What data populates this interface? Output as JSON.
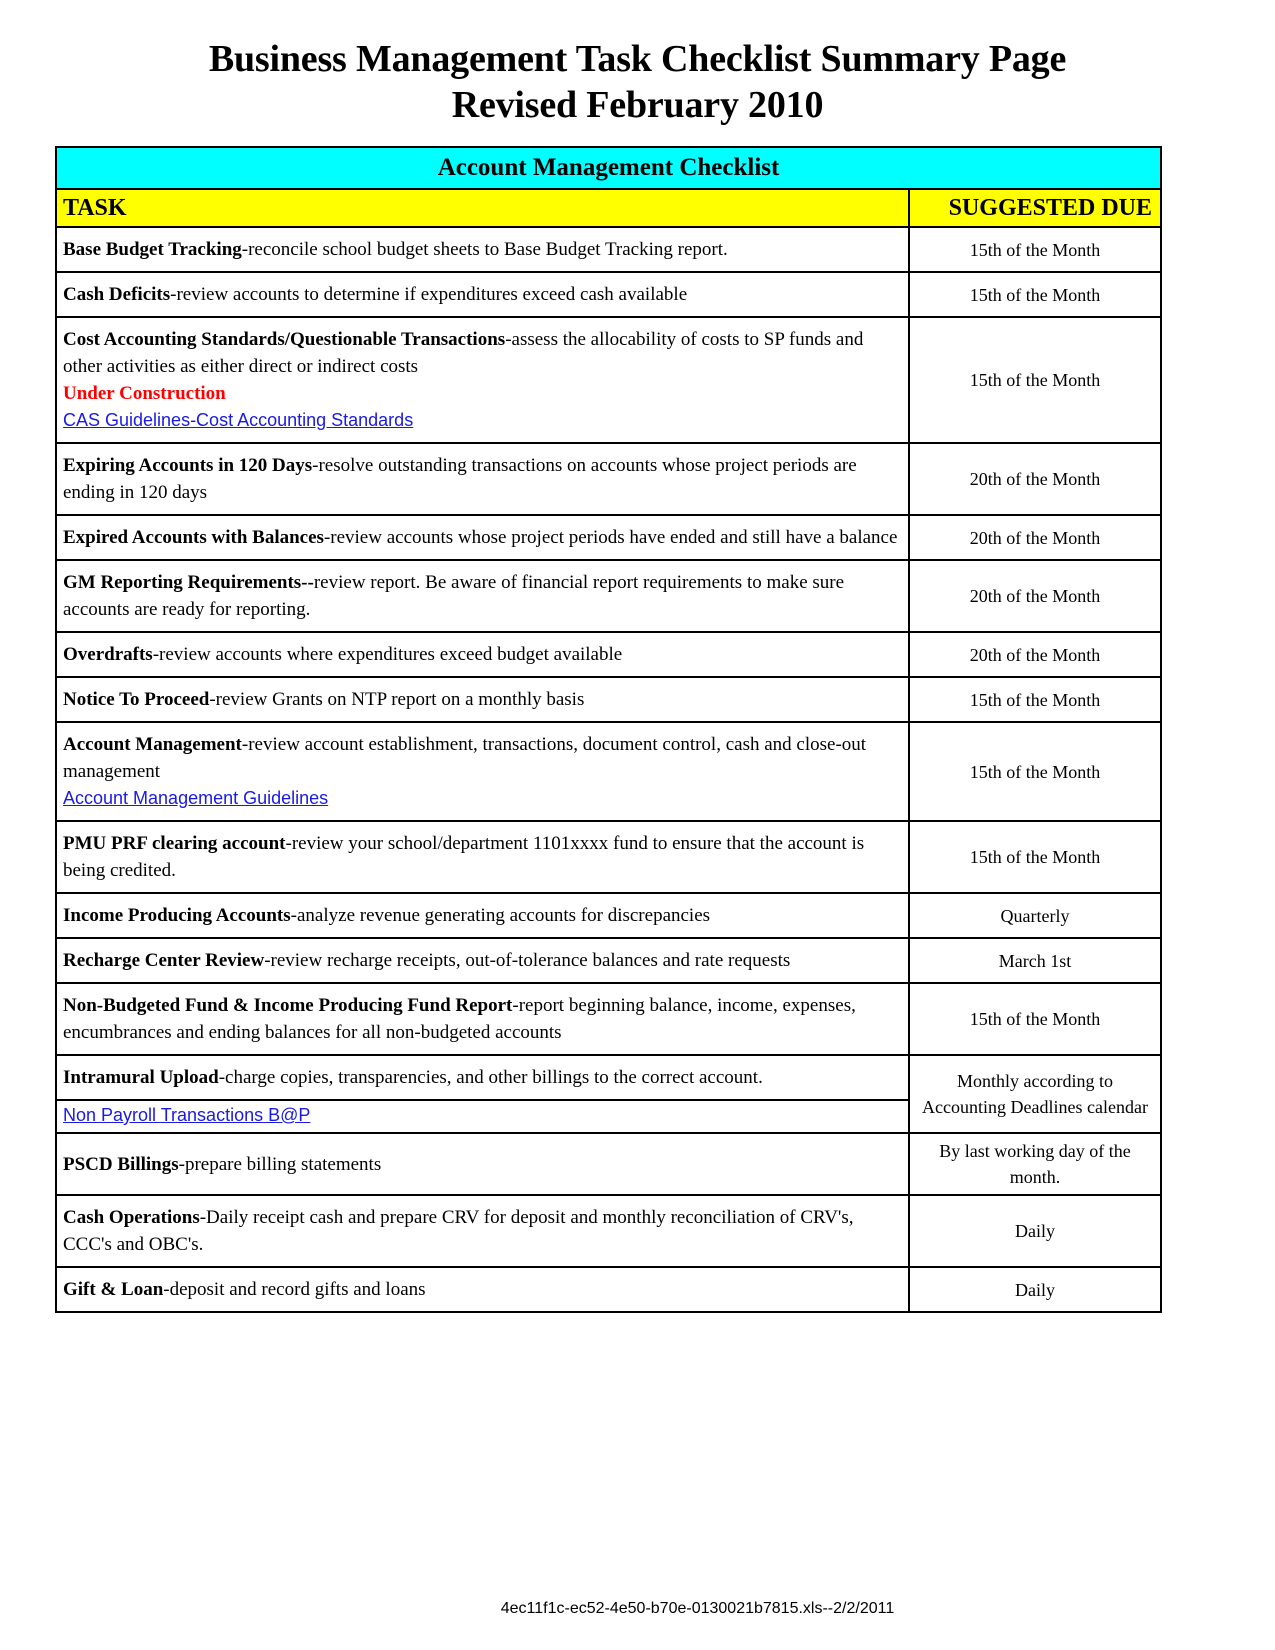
{
  "document": {
    "title_line1": "Business Management Task Checklist Summary Page",
    "title_line2": "Revised February 2010",
    "footer_text": "4ec11f1c-ec52-4e50-b70e-0130021b7815.xls--2/2/2011"
  },
  "colors": {
    "banner_background": "#00ffff",
    "header_background": "#ffff00",
    "link": "#1a1ae6",
    "warning": "#ff0000",
    "border": "#000000"
  },
  "table": {
    "banner": "Account Management Checklist",
    "columns": {
      "task": "TASK",
      "due": "SUGGESTED DUE"
    },
    "rows": [
      {
        "task_bold": "Base Budget Tracking",
        "task_rest": "-reconcile school budget sheets to Base Budget Tracking report.",
        "due": "15th of the Month"
      },
      {
        "task_bold": "Cash Deficits",
        "task_rest": "-review accounts to determine if expenditures exceed cash available",
        "due": "15th of the Month"
      },
      {
        "task_bold": "Cost Accounting Standards/Questionable Transactions",
        "task_rest": "-assess the allocability of costs to SP funds and other activities as either direct or indirect costs",
        "warning": "Under Construction",
        "link": "CAS Guidelines-Cost Accounting Standards",
        "due": "15th of the Month"
      },
      {
        "task_bold": "Expiring Accounts in 120 Days",
        "task_rest": "-resolve outstanding transactions on accounts whose project periods are ending in 120 days",
        "due": "20th of the Month"
      },
      {
        "task_bold": "Expired Accounts with Balances",
        "task_rest": "-review accounts whose project periods have ended and still have a balance",
        "due": "20th of the Month"
      },
      {
        "task_bold": "GM Reporting Requirements--",
        "task_rest": "review report.  Be aware of financial report requirements to make sure accounts are ready for reporting.",
        "due": "20th of the Month"
      },
      {
        "task_bold": "Overdrafts",
        "task_rest": "-review accounts where expenditures exceed budget available",
        "due": "20th of the Month"
      },
      {
        "task_bold": "Notice To Proceed",
        "task_rest": "-review Grants on NTP report on a monthly basis",
        "due": "15th of the Month"
      },
      {
        "task_bold": "Account Management",
        "task_rest": "-review account establishment, transactions, document control, cash and close-out management",
        "link": "Account Management Guidelines",
        "due": "15th of the Month"
      },
      {
        "task_bold": "PMU PRF clearing account",
        "task_rest": "-review your school/department 1101xxxx fund to ensure that the account is being credited.",
        "due": "15th of the Month"
      },
      {
        "task_bold": "Income Producing Accounts",
        "task_rest": "-analyze revenue generating accounts for discrepancies",
        "due": "Quarterly"
      },
      {
        "task_bold": "Recharge Center Review",
        "task_rest": "-review recharge receipts, out-of-tolerance balances and rate requests",
        "due": "March 1st"
      },
      {
        "task_bold": "Non-Budgeted Fund & Income Producing Fund Report",
        "task_rest": "-report beginning balance, income, expenses, encumbrances and ending balances for all non-budgeted accounts",
        "due": "15th of the Month"
      },
      {
        "task_bold": "Intramural Upload",
        "task_rest": "-charge copies, transparencies, and other billings to the correct account.",
        "sublink": "Non Payroll Transactions B@P",
        "due": "Monthly according to Accounting Deadlines calendar"
      },
      {
        "task_bold": "PSCD Billings",
        "task_rest": "-prepare billing statements",
        "due": "By last working day of the month."
      },
      {
        "task_bold": "Cash Operations",
        "task_rest": "-Daily receipt cash and prepare CRV for deposit and monthly reconciliation of CRV's, CCC's  and OBC's.",
        "due": "Daily"
      },
      {
        "task_bold": "Gift & Loan",
        "task_rest": "-deposit and record gifts and loans",
        "due": "Daily"
      }
    ]
  }
}
